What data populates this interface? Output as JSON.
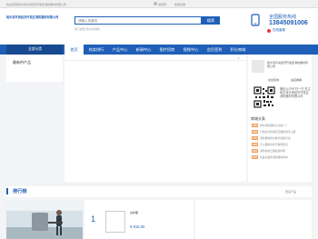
{
  "topbar": {
    "message": "欢迎来到哈尔滨平房经济开发区消防器材有限公司",
    "login": "请登录",
    "register": "免费注册"
  },
  "header": {
    "logo_text": "哈尔滨平房经济开发区消防器材有限公司",
    "search_placeholder": "请输入关键词",
    "search_button": "搜索",
    "hot_words": "热门搜索 哈尔滨消防",
    "hotline_label": "全国服务热线",
    "hotline_number": "13845091006",
    "online_label": "在线客服"
  },
  "nav": {
    "category": "全部分类",
    "items": [
      {
        "label": "首页",
        "active": true
      },
      {
        "label": "热卖排行",
        "active": false
      },
      {
        "label": "产品中心",
        "active": false
      },
      {
        "label": "新闻中心",
        "active": false
      },
      {
        "label": "图片招商",
        "active": false
      },
      {
        "label": "视频中心",
        "active": false
      },
      {
        "label": "会员签到",
        "active": false
      },
      {
        "label": "积分商城",
        "active": false
      }
    ]
  },
  "leftcol": {
    "title": "最新供产品"
  },
  "company": {
    "name": "哈尔滨平房经济开发区消防器材有限公司",
    "btn1": "在线咨询",
    "btn2": "进店看看",
    "qr_text": "微信公众号 扫一扫 关注哈尔滨平房经济开发区消防器材有限公司"
  },
  "news": {
    "title": "商城头条",
    "items": [
      {
        "tag": "新闻",
        "text": "你对消防器材认识多少?"
      },
      {
        "tag": "新闻",
        "text": "日常生活中如何正确使用灭火器"
      },
      {
        "tag": "新闻",
        "text": "消防器材的分类与使用方法"
      },
      {
        "tag": "新闻",
        "text": "灭火器的检查与保养知识"
      },
      {
        "tag": "新闻",
        "text": "消防栓的正确使用步骤"
      },
      {
        "tag": "新闻",
        "text": "家庭必备的消防器材清单"
      }
    ]
  },
  "ranking": {
    "title": "排行榜",
    "more": "更多产品",
    "item": {
      "num": "1",
      "name": "白护服",
      "price": "¥ 615.00"
    }
  }
}
